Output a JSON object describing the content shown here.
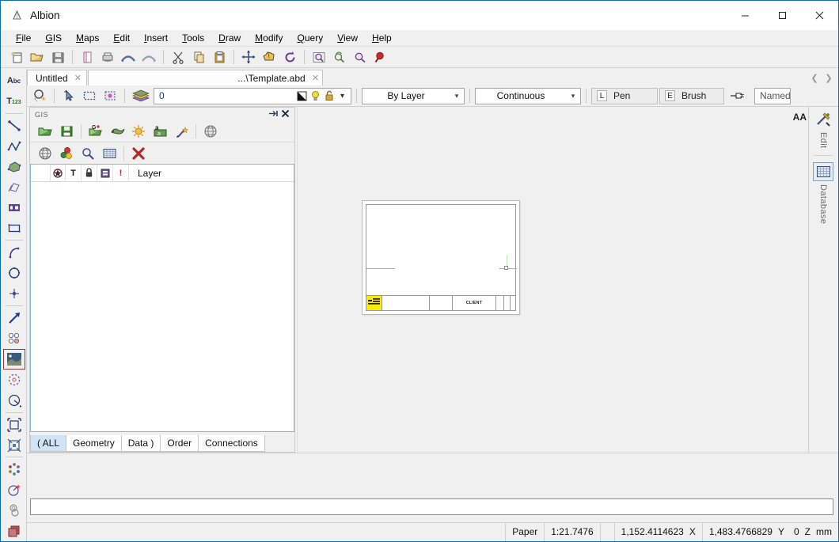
{
  "window": {
    "title": "Albion",
    "app_icon": "albion-icon",
    "minimize": "—",
    "maximize": "□",
    "close": "✕"
  },
  "menu": {
    "items": [
      {
        "label": "File",
        "accel": "F"
      },
      {
        "label": "GIS",
        "accel": "G"
      },
      {
        "label": "Maps",
        "accel": "M"
      },
      {
        "label": "Edit",
        "accel": "E"
      },
      {
        "label": "Insert",
        "accel": "I"
      },
      {
        "label": "Tools",
        "accel": "T"
      },
      {
        "label": "Draw",
        "accel": "D"
      },
      {
        "label": "Modify",
        "accel": "M"
      },
      {
        "label": "Query",
        "accel": "Q"
      },
      {
        "label": "View",
        "accel": "V"
      },
      {
        "label": "Help",
        "accel": "H"
      }
    ]
  },
  "main_toolbar": {
    "buttons": [
      {
        "name": "new-file-icon"
      },
      {
        "name": "open-folder-icon"
      },
      {
        "name": "save-icon"
      },
      {
        "sep": true
      },
      {
        "name": "page-setup-icon"
      },
      {
        "name": "print-icon"
      },
      {
        "name": "undo-icon"
      },
      {
        "name": "redo-icon"
      },
      {
        "sep": true
      },
      {
        "name": "cut-scissors-icon"
      },
      {
        "name": "copy-icon"
      },
      {
        "name": "paste-icon"
      },
      {
        "sep": true
      },
      {
        "name": "move-icon"
      },
      {
        "name": "pan-hand-icon"
      },
      {
        "name": "rotate-icon"
      },
      {
        "sep": true
      },
      {
        "name": "zoom-window-icon"
      },
      {
        "name": "zoom-previous-icon"
      },
      {
        "name": "zoom-extents-icon"
      },
      {
        "name": "zoom-in-icon"
      }
    ]
  },
  "left_toolbar": {
    "buttons": [
      {
        "name": "text-abc-icon",
        "glyph": "Abc"
      },
      {
        "name": "text-style-icon",
        "glyph": "T123"
      },
      {
        "sep": true
      },
      {
        "name": "line-icon"
      },
      {
        "name": "polyline-icon"
      },
      {
        "name": "polygon-fill-icon"
      },
      {
        "name": "parallelogram-icon"
      },
      {
        "name": "rectangle-pattern-icon"
      },
      {
        "name": "rectangle-icon"
      },
      {
        "sep": true
      },
      {
        "name": "arc-icon"
      },
      {
        "name": "circle-icon"
      },
      {
        "name": "point-icon"
      },
      {
        "sep": true
      },
      {
        "name": "arrow-up-right-icon"
      },
      {
        "name": "symbols-icon"
      },
      {
        "name": "raster-image-icon"
      },
      {
        "name": "selection-dashed-icon"
      },
      {
        "name": "measure-angle-icon"
      },
      {
        "sep": true
      },
      {
        "name": "fit-window-icon"
      },
      {
        "name": "scale-icon"
      },
      {
        "sep": true
      },
      {
        "name": "thematic-icon"
      },
      {
        "name": "query-circle-icon"
      },
      {
        "name": "topology-icon"
      },
      {
        "name": "layers-stack-icon"
      }
    ]
  },
  "document_tabs": {
    "tabs": [
      {
        "label": "Untitled",
        "close": "✕",
        "active": false
      },
      {
        "label": "...\\Template.abd",
        "close": "✕",
        "active": true
      }
    ],
    "nav_prev": "❮",
    "nav_next": "❯"
  },
  "properties_toolbar": {
    "buttons": [
      {
        "name": "select-object-icon"
      },
      {
        "sep": true
      },
      {
        "name": "pick-arrow-icon"
      },
      {
        "name": "select-window-icon"
      },
      {
        "name": "select-all-icon"
      },
      {
        "sep": true
      },
      {
        "name": "layer-stack-icon"
      }
    ],
    "layer_value": "0",
    "layer_icons": [
      {
        "name": "layer-color-icon"
      },
      {
        "name": "layer-visible-bulb-icon"
      },
      {
        "name": "layer-lock-icon"
      },
      {
        "name": "layer-dropdown-icon",
        "glyph": "⌄"
      }
    ],
    "color_combo": {
      "value": "By Layer",
      "arrow": "⌄"
    },
    "linetype_combo": {
      "value": "Continuous",
      "arrow": "⌄"
    },
    "pen_button": {
      "key": "L",
      "label": "Pen"
    },
    "brush_button": {
      "key": "E",
      "label": "Brush"
    },
    "pointer_icon": "pointer-hand-icon",
    "named_box": {
      "value": "Named"
    }
  },
  "gis_panel": {
    "title": "GIS",
    "pin_icon": "⇥",
    "close_icon": "✕",
    "toolbar_row1": [
      {
        "name": "gis-open-folder-icon"
      },
      {
        "name": "gis-save-icon"
      },
      {
        "sep": true
      },
      {
        "name": "gis-add-layer-icon"
      },
      {
        "name": "gis-geometry-icon"
      },
      {
        "name": "gis-thematic-sun-icon"
      },
      {
        "name": "gis-label-annotate-icon"
      },
      {
        "name": "gis-style-wizard-icon"
      },
      {
        "sep": true
      },
      {
        "name": "gis-globe-icon"
      }
    ],
    "toolbar_row2": [
      {
        "name": "gis-web-globe-icon"
      },
      {
        "name": "gis-symbology-icon"
      },
      {
        "name": "gis-find-icon"
      },
      {
        "name": "gis-table-icon"
      },
      {
        "sep": true
      },
      {
        "name": "gis-delete-icon"
      }
    ],
    "list_header": {
      "columns": [
        {
          "name": "visibility-column-icon",
          "glyph": "✺"
        },
        {
          "name": "text-column-icon",
          "glyph": "T"
        },
        {
          "name": "lock-column-icon",
          "glyph": "⚿"
        },
        {
          "name": "table-column-icon",
          "glyph": "▣"
        },
        {
          "name": "alert-column-icon",
          "glyph": "!"
        }
      ],
      "layer_label": "Layer"
    },
    "rows": [],
    "tabs": [
      {
        "label": "( ALL",
        "active": true
      },
      {
        "label": "Geometry",
        "active": false
      },
      {
        "label": "Data )",
        "active": false
      },
      {
        "label": "Order",
        "active": false
      },
      {
        "label": "Connections",
        "active": false
      }
    ]
  },
  "canvas": {
    "sheet": {
      "client_label": "CLIENT",
      "stamp_icon": "title-stamp-icon"
    }
  },
  "right_panel": {
    "text_icon": "AA",
    "items": [
      {
        "icon_name": "edit-tools-icon",
        "label": "Edit",
        "selected": false
      },
      {
        "icon_name": "database-table-icon",
        "label": "Database",
        "selected": true
      }
    ]
  },
  "command_line": {
    "value": "",
    "placeholder": ""
  },
  "status_bar": {
    "mode": "Paper",
    "scale": "1:21.7476",
    "coord_x": "1,152.4114623",
    "coord_x_label": "X",
    "coord_y": "1,483.4766829",
    "coord_y_label": "Y",
    "coord_z": "0",
    "coord_z_label": "Z",
    "units": "mm"
  }
}
